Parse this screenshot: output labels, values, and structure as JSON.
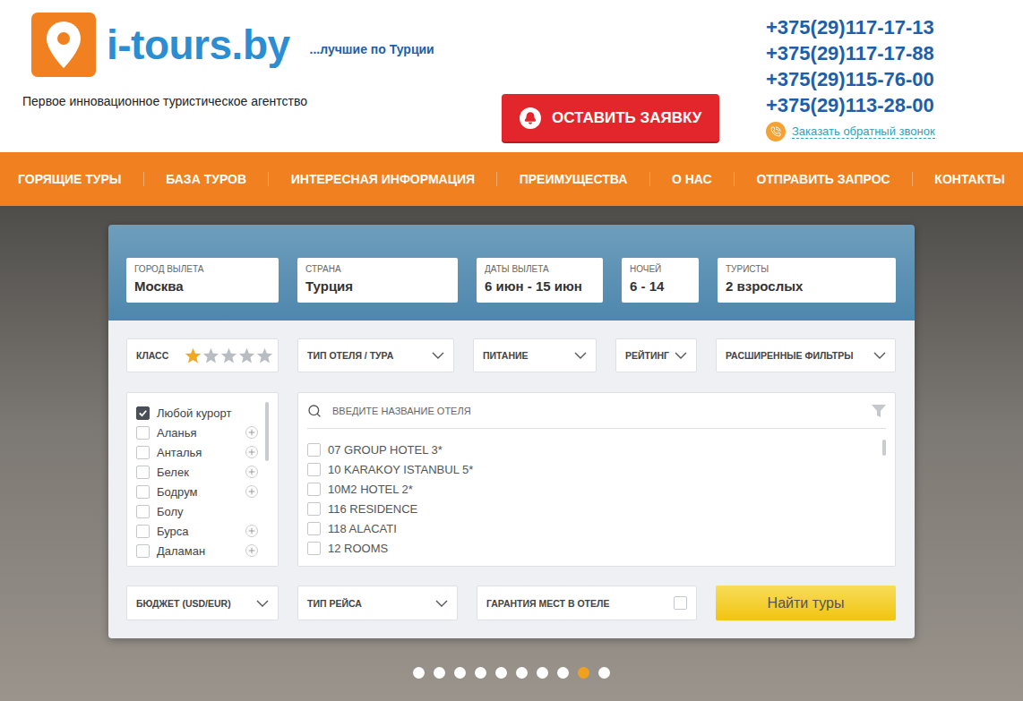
{
  "header": {
    "brand": "i-tours.by",
    "tagline": "...лучшие по Турции",
    "subtitle": "Первое инновационное туристическое агентство",
    "request_button": "ОСТАВИТЬ ЗАЯВКУ",
    "phones": [
      "+375(29)117-17-13",
      "+375(29)117-17-88",
      "+375(29)115-76-00",
      "+375(29)113-28-00"
    ],
    "callback_link": "Заказать обратный звонок"
  },
  "nav": [
    "ГОРЯЩИЕ ТУРЫ",
    "БАЗА ТУРОВ",
    "ИНТЕРЕСНАЯ ИНФОРМАЦИЯ",
    "ПРЕИМУЩЕСТВА",
    "О НАС",
    "ОТПРАВИТЬ ЗАПРОС",
    "КОНТАКТЫ"
  ],
  "search": {
    "fields": [
      {
        "label": "ГОРОД ВЫЛЕТА",
        "value": "Москва"
      },
      {
        "label": "СТРАНА",
        "value": "Турция"
      },
      {
        "label": "ДАТЫ ВЫЛЕТА",
        "value": "6 июн - 15 июн"
      },
      {
        "label": "НОЧЕЙ",
        "value": "6 - 14"
      },
      {
        "label": "ТУРИСТЫ",
        "value": "2 взрослых"
      }
    ],
    "class_filter": {
      "label": "КЛАСС",
      "stars": 1
    },
    "dropdowns": [
      "ТИП ОТЕЛЯ / ТУРА",
      "ПИТАНИЕ",
      "РЕЙТИНГ",
      "РАСШИРЕННЫЕ ФИЛЬТРЫ"
    ],
    "resorts": [
      {
        "name": "Любой курорт",
        "checked": true,
        "expandable": false
      },
      {
        "name": "Аланья",
        "checked": false,
        "expandable": true
      },
      {
        "name": "Анталья",
        "checked": false,
        "expandable": true
      },
      {
        "name": "Белек",
        "checked": false,
        "expandable": true
      },
      {
        "name": "Бодрум",
        "checked": false,
        "expandable": true
      },
      {
        "name": "Болу",
        "checked": false,
        "expandable": false
      },
      {
        "name": "Бурса",
        "checked": false,
        "expandable": true
      },
      {
        "name": "Даламан",
        "checked": false,
        "expandable": true
      }
    ],
    "hotel_search": {
      "placeholder": "ВВЕДИТЕ НАЗВАНИЕ ОТЕЛЯ"
    },
    "hotels": [
      {
        "name": "07 GROUP HOTEL 3*",
        "checked": false
      },
      {
        "name": "10 KARAKOY ISTANBUL 5*",
        "checked": false
      },
      {
        "name": "10M2 HOTEL 2*",
        "checked": false
      },
      {
        "name": "116 RESIDENCE",
        "checked": false
      },
      {
        "name": "118 ALACATI",
        "checked": false
      },
      {
        "name": "12 ROOMS",
        "checked": false
      }
    ],
    "bottom_dropdowns": [
      "БЮДЖЕТ (USD/EUR)",
      "ТИП РЕЙСА"
    ],
    "guarantee": {
      "label": "ГАРАНТИЯ МЕСТ В ОТЕЛЕ",
      "checked": false
    },
    "submit": "Найти туры"
  },
  "carousel": {
    "dots": [
      {
        "selected": false
      },
      {
        "selected": false
      },
      {
        "selected": false
      },
      {
        "selected": false
      },
      {
        "selected": false
      },
      {
        "selected": false
      },
      {
        "selected": false
      },
      {
        "selected": false
      },
      {
        "selected": true
      },
      {
        "selected": false
      }
    ]
  }
}
